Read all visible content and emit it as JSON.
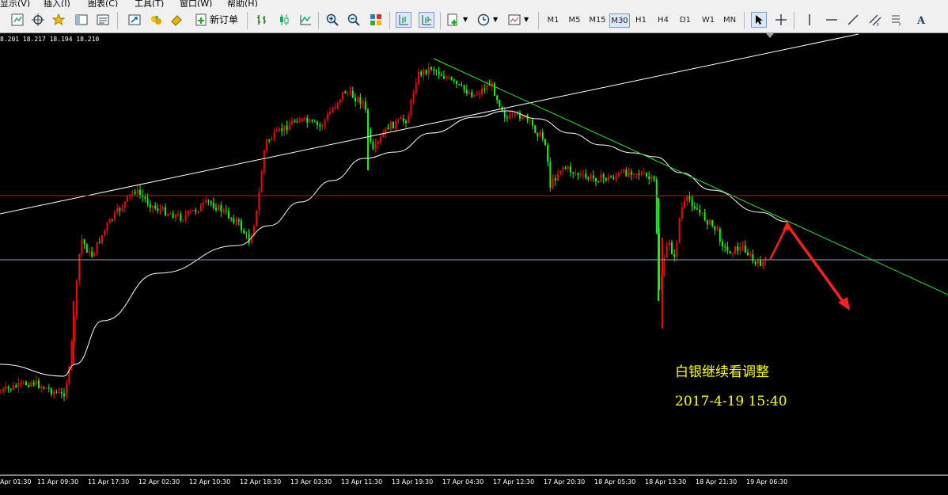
{
  "menu": {
    "items": [
      "显示(V)",
      "插入(I)",
      "图表(C)",
      "工具(T)",
      "窗口(W)",
      "帮助(H)"
    ]
  },
  "toolbar": {
    "new_order_label": "新订单",
    "icons": [
      "new-chart-icon",
      "crosshair-icon",
      "favorites-icon",
      "navigator-icon",
      "history-icon",
      "expert-advisors-icon",
      "new-order-icon",
      "bar-chart-icon",
      "candlestick-icon",
      "line-chart-icon",
      "zoom-in-icon",
      "zoom-out-icon",
      "tile-windows-icon",
      "chart-shift-icon",
      "autoscroll-icon",
      "indicators-icon",
      "periods-icon",
      "templates-icon",
      "cursor-icon",
      "crosshair-tool-icon",
      "vertical-line-icon",
      "horizontal-line-icon",
      "trendline-icon",
      "channel-icon",
      "fibonacci-icon",
      "text-icon"
    ],
    "timeframes": [
      "M1",
      "M5",
      "M15",
      "M30",
      "H1",
      "H4",
      "D1",
      "W1",
      "MN"
    ],
    "selected_timeframe": "M30"
  },
  "chart": {
    "quote_line": "8.201 18.217 18.194 18.210",
    "background": "#000000",
    "bull_color": "#ff0000",
    "bear_color": "#00ff00",
    "annotation_title": "白银继续看调整",
    "annotation_time": "2017-4-19  15:40",
    "annotation_color": "#ffff00",
    "arrow_color": "#ff2020",
    "x_ticks": [
      "Apr 01:30",
      "11 Apr 09:30",
      "11 Apr 17:30",
      "12 Apr 02:30",
      "12 Apr 10:30",
      "12 Apr 18:30",
      "13 Apr 03:30",
      "13 Apr 11:30",
      "13 Apr 19:30",
      "17 Apr 04:30",
      "17 Apr 12:30",
      "17 Apr 20:30",
      "18 Apr 05:30",
      "18 Apr 13:30",
      "18 Apr 21:30",
      "19 Apr 06:30"
    ]
  }
}
